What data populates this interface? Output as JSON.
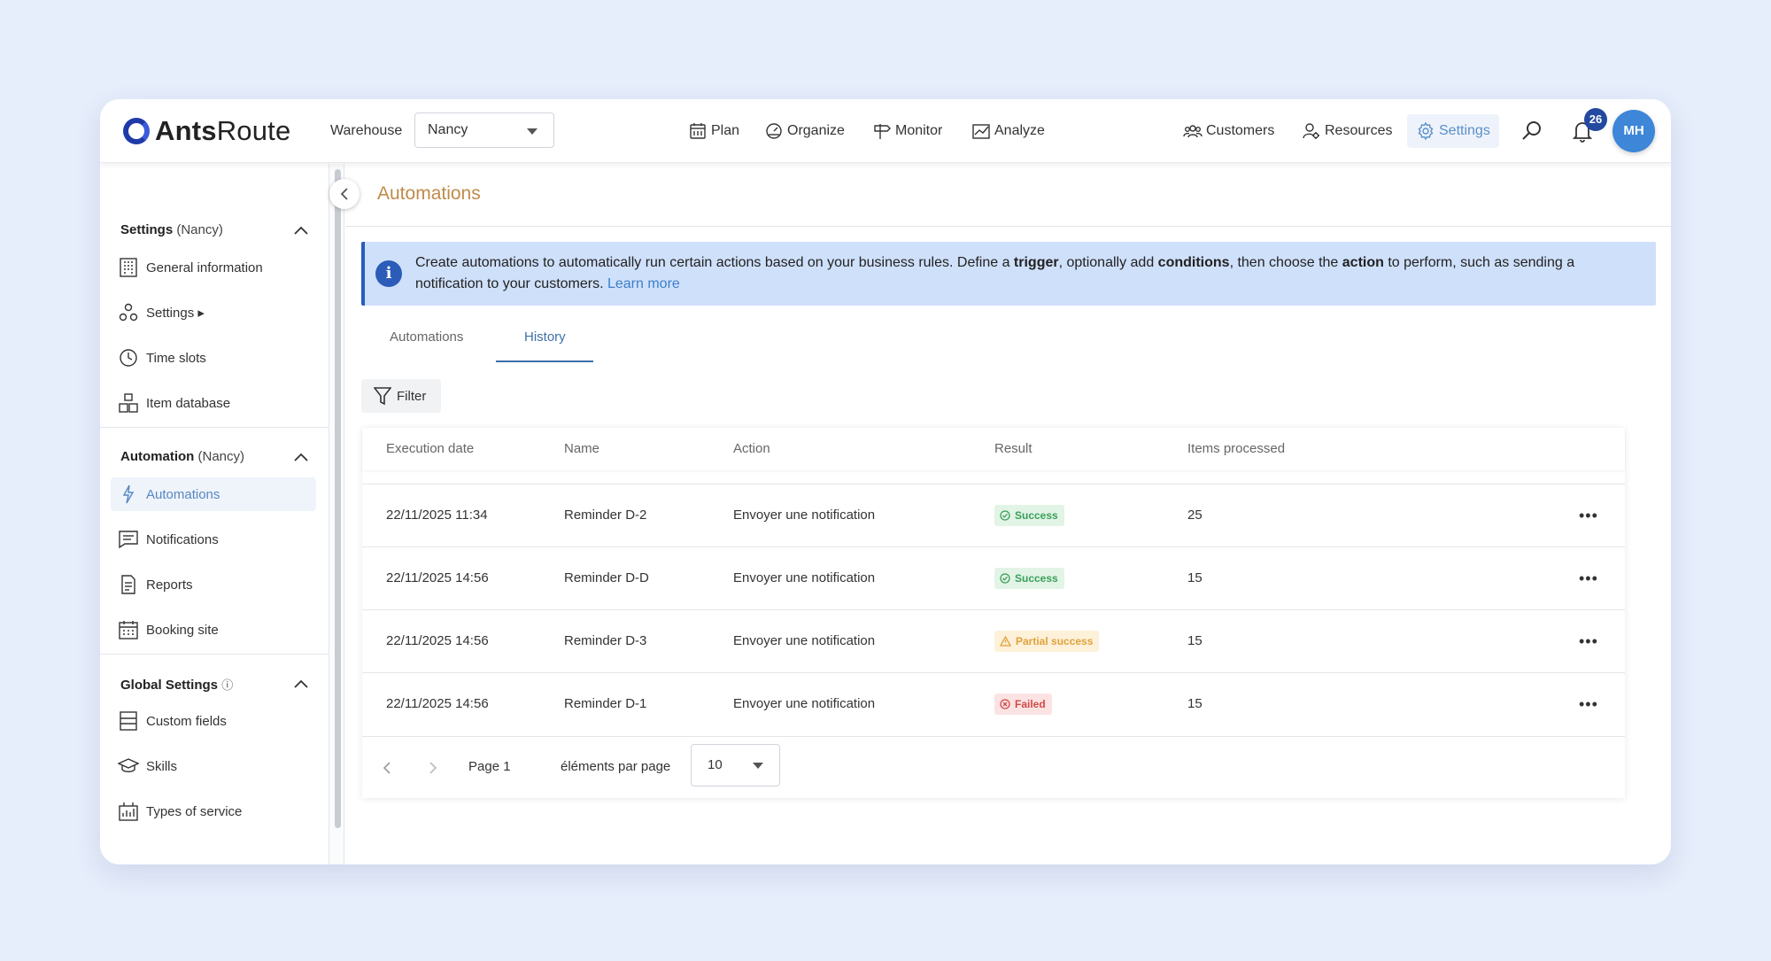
{
  "topbar": {
    "logo_bold": "Ants",
    "logo_light": "Route",
    "warehouse_label": "Warehouse",
    "warehouse_value": "Nancy",
    "nav": [
      {
        "label": "Plan",
        "icon": "calendar-icon"
      },
      {
        "label": "Organize",
        "icon": "gauge-icon"
      },
      {
        "label": "Monitor",
        "icon": "signpost-icon"
      },
      {
        "label": "Analyze",
        "icon": "chart-icon"
      }
    ],
    "right_nav": [
      {
        "label": "Customers",
        "icon": "people-icon"
      },
      {
        "label": "Resources",
        "icon": "user-gear-icon"
      },
      {
        "label": "Settings",
        "icon": "gear-icon",
        "active": true
      }
    ],
    "notification_count": "26",
    "avatar_initials": "MH"
  },
  "sidebar": {
    "sections": [
      {
        "title": "Settings",
        "suffix": "(Nancy)",
        "items": [
          {
            "label": "General information",
            "icon": "building-icon"
          },
          {
            "label": "Settings ▸",
            "icon": "settings-cluster-icon"
          },
          {
            "label": "Time slots",
            "icon": "clock-icon"
          },
          {
            "label": "Item database",
            "icon": "boxes-icon"
          }
        ]
      },
      {
        "title": "Automation",
        "suffix": "(Nancy)",
        "items": [
          {
            "label": "Automations",
            "icon": "lightning-icon",
            "active": true
          },
          {
            "label": "Notifications",
            "icon": "message-icon"
          },
          {
            "label": "Reports",
            "icon": "document-icon"
          },
          {
            "label": "Booking site",
            "icon": "calendar-grid-icon"
          }
        ]
      },
      {
        "title": "Global Settings",
        "suffix": "ⓘ",
        "items": [
          {
            "label": "Custom fields",
            "icon": "fields-icon"
          },
          {
            "label": "Skills",
            "icon": "graduation-cap-icon"
          },
          {
            "label": "Types of service",
            "icon": "service-chart-icon"
          }
        ]
      }
    ]
  },
  "main": {
    "title": "Automations",
    "info": {
      "part1": "Create automations to automatically run certain actions based on your business rules. Define a ",
      "trigger": "trigger",
      "part2": ", optionally add ",
      "conditions": "conditions",
      "part3": ", then choose the ",
      "action": "action",
      "part4": " to perform, such as sending a notification to your customers. ",
      "link": "Learn more"
    },
    "tabs": [
      {
        "label": "Automations",
        "active": false
      },
      {
        "label": "History",
        "active": true
      }
    ],
    "filter_label": "Filter",
    "table": {
      "headers": [
        "Execution date",
        "Name",
        "Action",
        "Result",
        "Items processed"
      ],
      "rows": [
        {
          "date": "22/11/2025 11:34",
          "name": "Reminder D-2",
          "action": "Envoyer une notification",
          "result": "Success",
          "status": "success",
          "items": "25"
        },
        {
          "date": "22/11/2025 14:56",
          "name": "Reminder D-D",
          "action": "Envoyer une notification",
          "result": "Success",
          "status": "success",
          "items": "15"
        },
        {
          "date": "22/11/2025 14:56",
          "name": "Reminder D-3",
          "action": "Envoyer une notification",
          "result": "Partial success",
          "status": "partial",
          "items": "15"
        },
        {
          "date": "22/11/2025 14:56",
          "name": "Reminder D-1",
          "action": "Envoyer une notification",
          "result": "Failed",
          "status": "failed",
          "items": "15"
        }
      ]
    },
    "pager": {
      "page_label": "Page 1",
      "per_page_label": "éléments par page",
      "per_page_value": "10"
    }
  },
  "colors": {
    "accent": "#3d6fa8",
    "title": "#c08a4a",
    "info_bg": "#cfe0fb",
    "success": "#3aa05a",
    "partial": "#e1a23c",
    "failed": "#d24a4a"
  }
}
